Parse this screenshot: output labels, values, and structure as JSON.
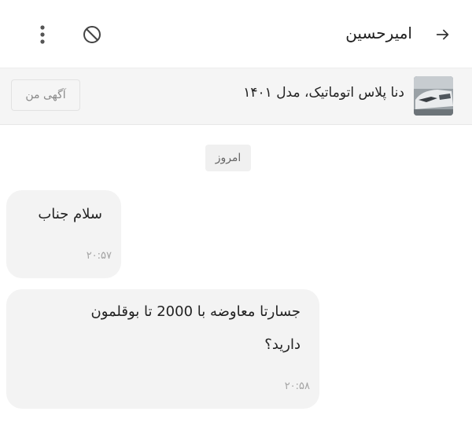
{
  "header": {
    "contact_name": "امیرحسین",
    "back_icon": "arrow-right-icon",
    "menu_icon": "more-vertical-icon",
    "block_icon": "block-icon"
  },
  "listing": {
    "title": "دنا پلاس اتوماتیک، مدل ۱۴۰۱",
    "my_ad_label": "آگهی من",
    "thumbnail": "car-photo"
  },
  "chat": {
    "date_label": "امروز",
    "messages": [
      {
        "lines": [
          "سلام جناب"
        ],
        "time": "۲۰:۵۷"
      },
      {
        "lines": [
          "جسارتا معاوضه با 2000 تا بوقلمون",
          "دارید؟"
        ],
        "time": "۲۰:۵۸"
      }
    ]
  }
}
